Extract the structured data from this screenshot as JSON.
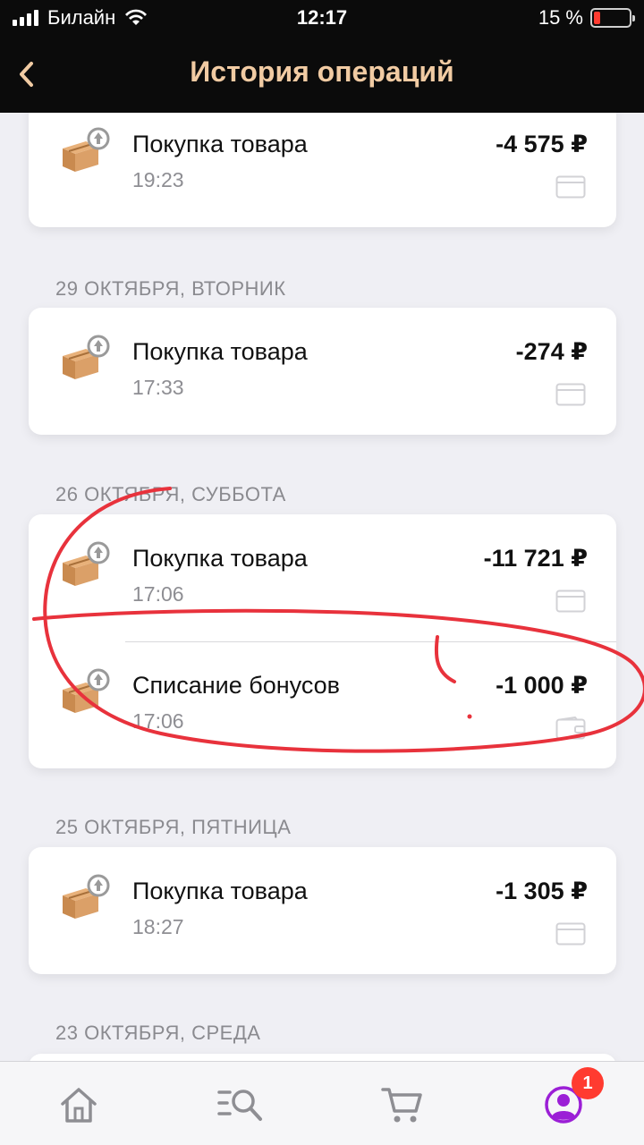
{
  "status_bar": {
    "carrier": "Билайн",
    "time": "12:17",
    "battery": "15 %",
    "battery_level": 0.15
  },
  "header": {
    "title": "История операций"
  },
  "operations": [
    {
      "title": "Покупка товара",
      "time": "19:23",
      "amount": "-4 575 ₽",
      "payment_icon": "card-icon"
    },
    {
      "date": "29 ОКТЯБРЯ, ВТОРНИК",
      "title": "Покупка товара",
      "time": "17:33",
      "amount": "-274 ₽",
      "payment_icon": "card-icon"
    },
    {
      "date": "26 ОКТЯБРЯ, СУББОТА",
      "title": "Покупка товара",
      "time": "17:06",
      "amount": "-11 721 ₽",
      "payment_icon": "card-icon"
    },
    {
      "title": "Списание бонусов",
      "time": "17:06",
      "amount": "-1 000 ₽",
      "payment_icon": "wallet-icon"
    },
    {
      "date": "25 ОКТЯБРЯ, ПЯТНИЦА",
      "title": "Покупка товара",
      "time": "18:27",
      "amount": "-1 305 ₽",
      "payment_icon": "card-icon"
    },
    {
      "date": "23 ОКТЯБРЯ, СРЕДА"
    }
  ],
  "tabbar": {
    "tabs": [
      {
        "name": "home-icon"
      },
      {
        "name": "search-icon"
      },
      {
        "name": "cart-icon"
      },
      {
        "name": "profile-icon"
      }
    ],
    "profile_badge": "1",
    "accent_color": "#9b1fd6"
  },
  "annotation": {
    "color": "#e8323c"
  }
}
